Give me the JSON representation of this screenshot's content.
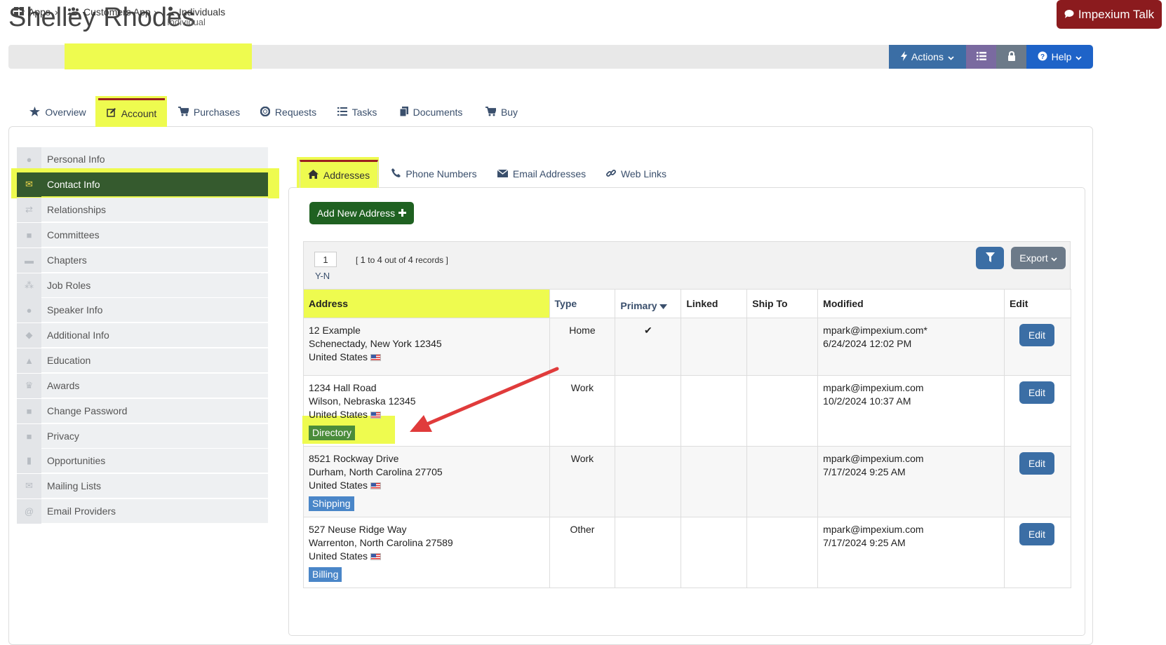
{
  "header": {
    "title": "Shelley Rhodes",
    "subtitle": "Individual",
    "talk_button": "Impexium Talk"
  },
  "breadcrumb": {
    "items": [
      "Apps",
      "Customers App",
      "Individuals"
    ]
  },
  "toolbar": {
    "actions": "Actions",
    "help": "Help"
  },
  "top_tabs": [
    "Overview",
    "Account",
    "Purchases",
    "Requests",
    "Tasks",
    "Documents",
    "Buy"
  ],
  "sidebar": {
    "items": [
      "Personal Info",
      "Contact Info",
      "Relationships",
      "Committees",
      "Chapters",
      "Job Roles",
      "Speaker Info",
      "Additional Info",
      "Education",
      "Awards",
      "Change Password",
      "Privacy",
      "Opportunities",
      "Mailing Lists",
      "Email Providers"
    ]
  },
  "inner_tabs": [
    "Addresses",
    "Phone Numbers",
    "Email Addresses",
    "Web Links"
  ],
  "add_button": "Add New Address",
  "grid": {
    "page": "1",
    "page_label": "Y-N",
    "records_from": "1",
    "records_to": "4",
    "records_total": "4",
    "records_to_word": "to",
    "records_out_of_word": "out of",
    "records_word": "records",
    "export": "Export",
    "columns": [
      "Address",
      "Type",
      "Primary",
      "Linked",
      "Ship To",
      "Modified",
      "Edit"
    ],
    "rows": [
      {
        "line1": "12 Example",
        "line2": "Schenectady, New York 12345",
        "country": "United States",
        "tag": "",
        "type": "Home",
        "primary": "✔",
        "modified_by": "mpark@impexium.com*",
        "modified_at": "6/24/2024 12:02 PM",
        "edit": "Edit"
      },
      {
        "line1": "1234 Hall Road",
        "line2": "Wilson, Nebraska 12345",
        "country": "United States",
        "tag": "Directory",
        "type": "Work",
        "primary": "",
        "modified_by": "mpark@impexium.com",
        "modified_at": "10/2/2024 10:37 AM",
        "edit": "Edit"
      },
      {
        "line1": "8521 Rockway Drive",
        "line2": "Durham, North Carolina 27705",
        "country": "United States",
        "tag": "Shipping",
        "type": "Work",
        "primary": "",
        "modified_by": "mpark@impexium.com",
        "modified_at": "7/17/2024 9:25 AM",
        "edit": "Edit"
      },
      {
        "line1": "527 Neuse Ridge Way",
        "line2": "Warrenton, North Carolina 27589",
        "country": "United States",
        "tag": "Billing",
        "type": "Other",
        "primary": "",
        "modified_by": "mpark@impexium.com",
        "modified_at": "7/17/2024 9:25 AM",
        "edit": "Edit"
      }
    ]
  }
}
